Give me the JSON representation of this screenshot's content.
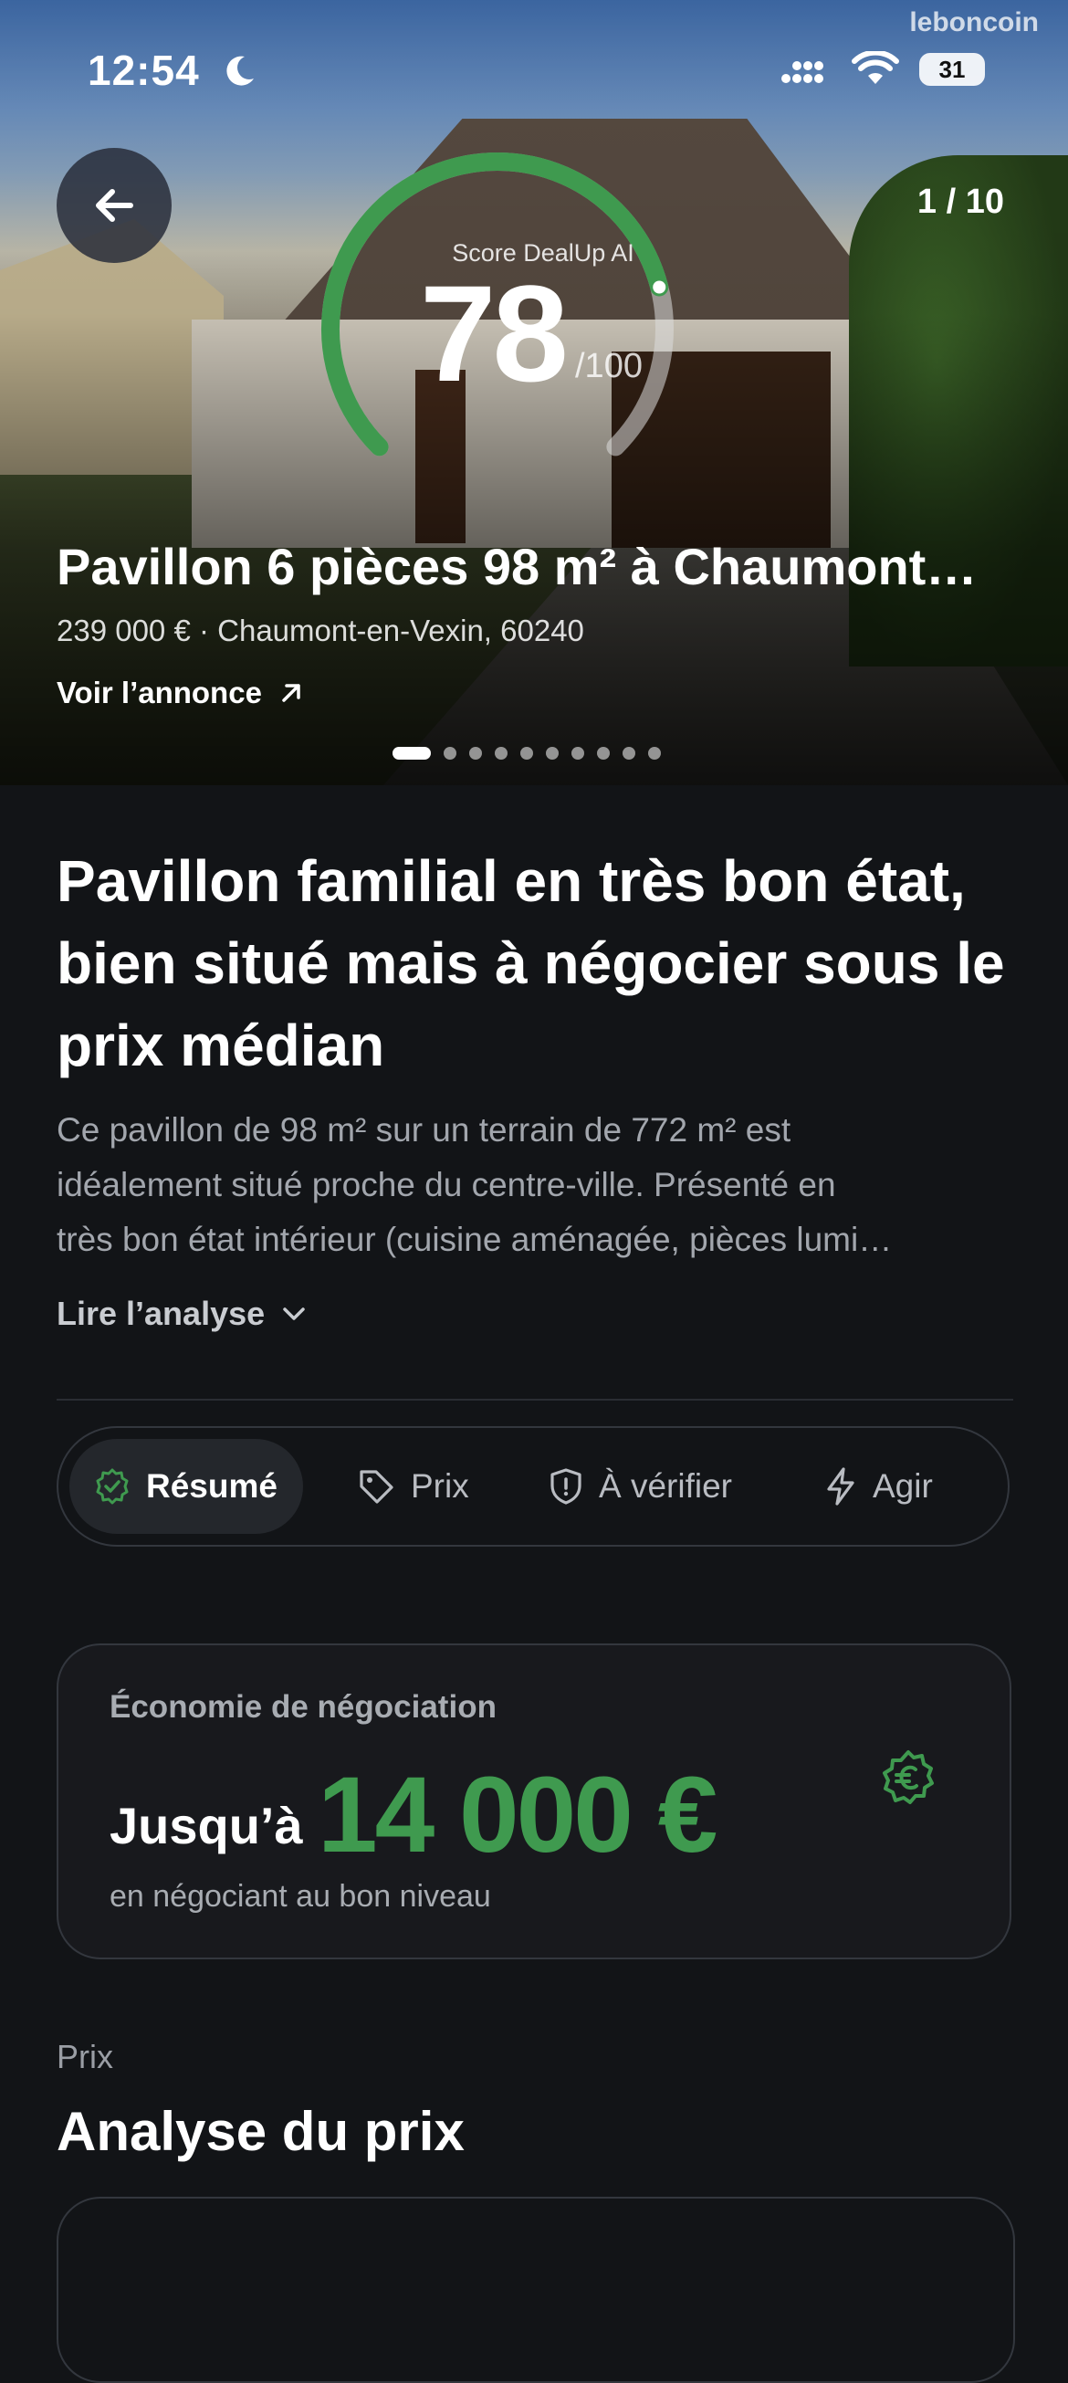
{
  "status_bar": {
    "time": "12:54",
    "battery": "31",
    "watermark": "leboncoin"
  },
  "gallery": {
    "counter": "1 / 10",
    "dot_count": 10,
    "active_dot": 0
  },
  "score": {
    "label": "Score DealUp AI",
    "value": "78",
    "max": "/100",
    "fraction": 0.78,
    "accent_color": "#3f9a4f"
  },
  "listing": {
    "title": "Pavillon 6 pièces 98 m² à Chaumont…",
    "subtitle": "239 000 € · Chaumont-en-Vexin, 60240",
    "link_label": "Voir l’annonce"
  },
  "analysis": {
    "headline": "Pavillon familial en très bon état, bien situé mais à négocier sous le prix médian",
    "description_lines": [
      "Ce pavillon de 98 m² sur un terrain de 772 m² est",
      "idéalement situé proche du centre-ville. Présenté en",
      "très bon état intérieur (cuisine aménagée, pièces lumi…"
    ],
    "read_more": "Lire l’analyse"
  },
  "tabs": [
    {
      "label": "Résumé",
      "icon": "check-badge-icon",
      "active": true
    },
    {
      "label": "Prix",
      "icon": "tag-icon",
      "active": false
    },
    {
      "label": "À vérifier",
      "icon": "shield-alert-icon",
      "active": false
    },
    {
      "label": "Agir",
      "icon": "lightning-icon",
      "active": false
    }
  ],
  "savings_card": {
    "label": "Économie de négociation",
    "prefix": "Jusqu’à",
    "amount": "14 000 €",
    "note": "en négociant au bon niveau",
    "icon": "euro-badge-icon"
  },
  "price_section": {
    "eyebrow": "Prix",
    "title": "Analyse du prix"
  }
}
